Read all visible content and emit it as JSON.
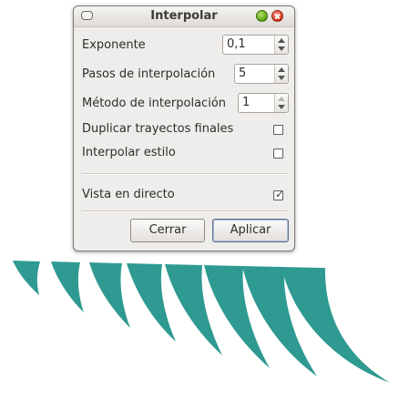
{
  "dialog": {
    "title": "Interpolar",
    "fields": [
      {
        "label": "Exponente",
        "value": "0,1"
      },
      {
        "label": "Pasos de interpolación",
        "value": "5"
      },
      {
        "label": "Método de interpolación",
        "value": "1"
      }
    ],
    "checkboxes": [
      {
        "label": "Duplicar trayectos finales",
        "checked": false
      },
      {
        "label": "Interpolar estilo",
        "checked": false
      },
      {
        "label": "Vista en directo",
        "checked": true
      }
    ],
    "buttons": {
      "close_label": "Cerrar",
      "apply_label": "Aplicar"
    }
  },
  "colors": {
    "shape_fill": "#2e9a91",
    "accent_border": "#5e6f8c"
  },
  "icons": [
    "window-menu-icon",
    "maximize-icon",
    "close-icon",
    "spin-up-icon",
    "spin-down-icon",
    "checkmark-icon"
  ]
}
